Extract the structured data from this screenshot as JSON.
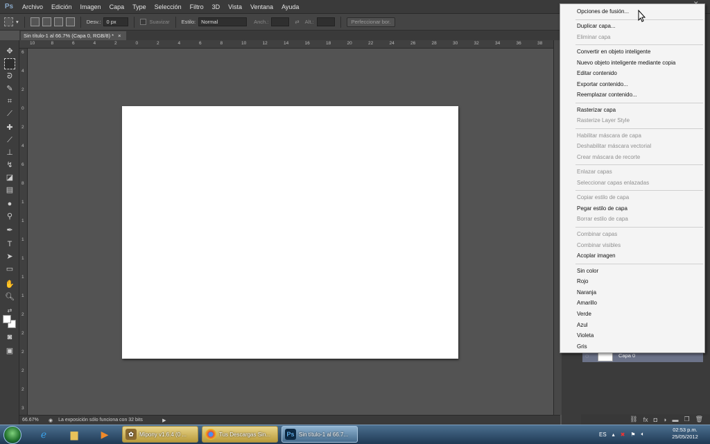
{
  "menubar": {
    "app_logo": "Ps",
    "items": [
      "Archivo",
      "Edición",
      "Imagen",
      "Capa",
      "Type",
      "Selección",
      "Filtro",
      "3D",
      "Vista",
      "Ventana",
      "Ayuda"
    ]
  },
  "options_bar": {
    "feather_label": "Desv.:",
    "feather_value": "0 px",
    "antialias_label": "Suavizar",
    "style_label": "Estilo:",
    "style_value": "Normal",
    "width_label": "Anch.:",
    "height_label": "Alt.:",
    "refine_button": "Perfeccionar bor."
  },
  "document_tab": {
    "title": "Sin título-1 al 66.7% (Capa 0, RGB/8) *",
    "close": "×"
  },
  "ruler_h_labels": [
    "10",
    "8",
    "6",
    "4",
    "2",
    "0",
    "2",
    "4",
    "6",
    "8",
    "10",
    "12",
    "14",
    "16",
    "18",
    "20",
    "22",
    "24",
    "26",
    "28",
    "30",
    "32",
    "34",
    "36",
    "38"
  ],
  "ruler_v_labels": [
    "6",
    "4",
    "2",
    "0",
    "2",
    "4",
    "6",
    "8",
    "1",
    "1",
    "1",
    "1",
    "1",
    "1",
    "2",
    "2",
    "2",
    "2",
    "2",
    "3"
  ],
  "status_bar": {
    "zoom": "66.67%",
    "message": "La exposición sólo funciona con 32 bits"
  },
  "layers_panel": {
    "layer_name": "Capa 0",
    "footer_icons": [
      "link-icon",
      "fx-icon",
      "mask-icon",
      "adjustment-icon",
      "folder-icon",
      "new-layer-icon",
      "trash-icon"
    ]
  },
  "context_menu": {
    "items": [
      {
        "label": "Opciones de fusión...",
        "enabled": true
      },
      {
        "label": "Duplicar capa...",
        "enabled": true
      },
      {
        "label": "Eliminar capa",
        "enabled": false
      },
      {
        "label": "Convertir en objeto inteligente",
        "enabled": true
      },
      {
        "label": "Nuevo objeto inteligente mediante copia",
        "enabled": true
      },
      {
        "label": "Editar contenido",
        "enabled": true
      },
      {
        "label": "Exportar contenido...",
        "enabled": true
      },
      {
        "label": "Reemplazar contenido...",
        "enabled": true
      },
      {
        "label": "Rasterizar capa",
        "enabled": true
      },
      {
        "label": "Rasterize Layer Style",
        "enabled": false
      },
      {
        "label": "Habilitar máscara de capa",
        "enabled": false
      },
      {
        "label": "Deshabilitar máscara vectorial",
        "enabled": false
      },
      {
        "label": "Crear máscara de recorte",
        "enabled": false
      },
      {
        "label": "Enlazar capas",
        "enabled": false
      },
      {
        "label": "Seleccionar capas enlazadas",
        "enabled": false
      },
      {
        "label": "Copiar estilo de capa",
        "enabled": false
      },
      {
        "label": "Pegar estilo de capa",
        "enabled": true
      },
      {
        "label": "Borrar estilo de capa",
        "enabled": false
      },
      {
        "label": "Combinar capas",
        "enabled": false
      },
      {
        "label": "Combinar visibles",
        "enabled": false
      },
      {
        "label": "Acoplar imagen",
        "enabled": true
      },
      {
        "label": "Sin color",
        "enabled": true
      },
      {
        "label": "Rojo",
        "enabled": true
      },
      {
        "label": "Naranja",
        "enabled": true
      },
      {
        "label": "Amarillo",
        "enabled": true
      },
      {
        "label": "Verde",
        "enabled": true
      },
      {
        "label": "Azul",
        "enabled": true
      },
      {
        "label": "Violeta",
        "enabled": true
      },
      {
        "label": "Gris",
        "enabled": true
      }
    ]
  },
  "taskbar": {
    "buttons": [
      {
        "label": "Mipony v1.6.4 (0 ...",
        "icon": "mipony-icon",
        "active": false
      },
      {
        "label": "Tus Descargas Sin...",
        "icon": "chrome-icon",
        "active": false
      },
      {
        "label": "Sin título-1 al 66.7...",
        "icon": "photoshop-icon",
        "active": true
      }
    ],
    "language": "ES",
    "time": "02:53 p.m.",
    "date": "25/05/2012"
  },
  "colors": {
    "workspace": "#535353",
    "menu_bg": "#f4f4f4",
    "selected_layer": "#6c7389",
    "taskbar": "#1f3954"
  }
}
